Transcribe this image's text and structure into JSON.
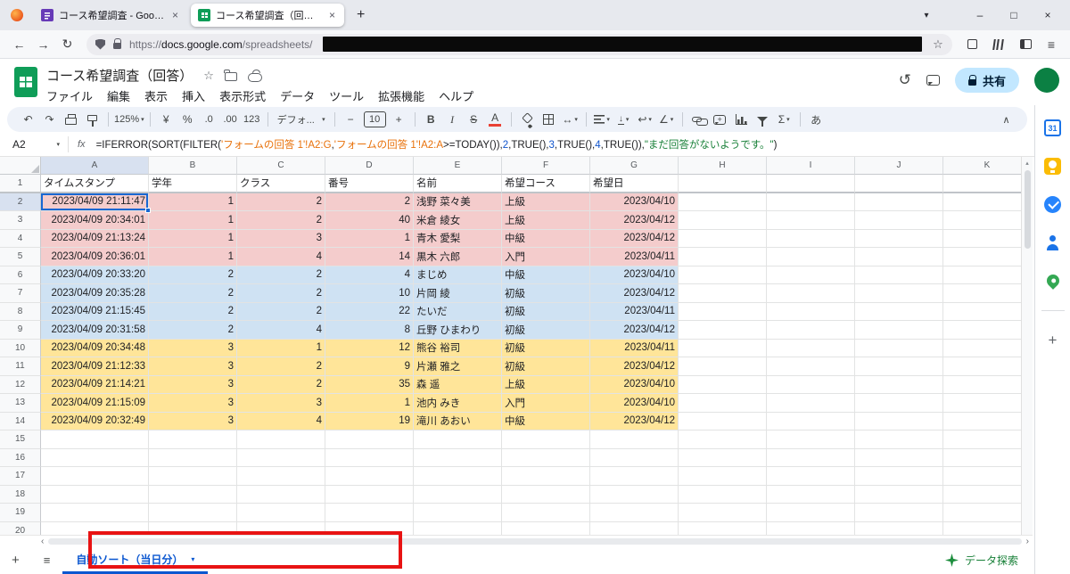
{
  "browser": {
    "tabs": [
      {
        "title": "コース希望調査 - Google フォーム"
      },
      {
        "title": "コース希望調査（回答） - Googl"
      }
    ],
    "url_parts": {
      "scheme": "https://",
      "domain": "docs.google.com",
      "path": "/spreadsheets/"
    }
  },
  "header": {
    "title": "コース希望調査（回答）",
    "menus": [
      "ファイル",
      "編集",
      "表示",
      "挿入",
      "表示形式",
      "データ",
      "ツール",
      "拡張機能",
      "ヘルプ"
    ],
    "share": "共有"
  },
  "toolbar": {
    "zoom": "125%",
    "currency": "¥",
    "percent": "%",
    "decrease_decimal": ".0",
    "increase_decimal": ".00",
    "number_format": "123",
    "font": "デフォ...",
    "font_size": "10",
    "bold": "B",
    "italic": "I",
    "strikethrough": "S",
    "text_color": "A",
    "input_tools": "あ"
  },
  "formula": {
    "cell_ref": "A2",
    "fx_label": "fx",
    "parts": [
      {
        "t": "=IFERROR(SORT(FILTER(",
        "c": "#202124"
      },
      {
        "t": "'フォームの回答 1'!A2:G",
        "c": "#e8710a"
      },
      {
        "t": ",",
        "c": "#202124"
      },
      {
        "t": "'フォームの回答 1'!A2:A",
        "c": "#e8710a"
      },
      {
        "t": ">=TODAY()),",
        "c": "#202124"
      },
      {
        "t": "2",
        "c": "#1155cc"
      },
      {
        "t": ",TRUE(),",
        "c": "#202124"
      },
      {
        "t": "3",
        "c": "#1155cc"
      },
      {
        "t": ",TRUE(),",
        "c": "#202124"
      },
      {
        "t": "4",
        "c": "#1155cc"
      },
      {
        "t": ",TRUE()),",
        "c": "#202124"
      },
      {
        "t": "\"まだ回答がないようです。\"",
        "c": "#188038"
      },
      {
        "t": ")",
        "c": "#202124"
      }
    ]
  },
  "grid": {
    "col_letters": [
      "A",
      "B",
      "C",
      "D",
      "E",
      "F",
      "G",
      "H",
      "I",
      "J",
      "K"
    ],
    "row_count": 20,
    "header_row": [
      "タイムスタンプ",
      "学年",
      "クラス",
      "番号",
      "名前",
      "希望コース",
      "希望日"
    ],
    "aligns": [
      "right",
      "right",
      "right",
      "right",
      "left",
      "left",
      "right"
    ],
    "colors": {
      "pink": "#f4cccc",
      "blue": "#cfe2f3",
      "yellow": "#ffe599"
    },
    "rows": [
      {
        "group": "pink",
        "cells": [
          "2023/04/09 21:11:47",
          "1",
          "2",
          "2",
          "浅野 菜々美",
          "上級",
          "2023/04/10"
        ]
      },
      {
        "group": "pink",
        "cells": [
          "2023/04/09 20:34:01",
          "1",
          "2",
          "40",
          "米倉 綾女",
          "上級",
          "2023/04/12"
        ]
      },
      {
        "group": "pink",
        "cells": [
          "2023/04/09 21:13:24",
          "1",
          "3",
          "1",
          "青木 愛梨",
          "中級",
          "2023/04/12"
        ]
      },
      {
        "group": "pink",
        "cells": [
          "2023/04/09 20:36:01",
          "1",
          "4",
          "14",
          "黒木 六郎",
          "入門",
          "2023/04/11"
        ]
      },
      {
        "group": "blue",
        "cells": [
          "2023/04/09 20:33:20",
          "2",
          "2",
          "4",
          "まじめ",
          "中級",
          "2023/04/10"
        ]
      },
      {
        "group": "blue",
        "cells": [
          "2023/04/09 20:35:28",
          "2",
          "2",
          "10",
          "片岡 綾",
          "初級",
          "2023/04/12"
        ]
      },
      {
        "group": "blue",
        "cells": [
          "2023/04/09 21:15:45",
          "2",
          "2",
          "22",
          "たいだ",
          "初級",
          "2023/04/11"
        ]
      },
      {
        "group": "blue",
        "cells": [
          "2023/04/09 20:31:58",
          "2",
          "4",
          "8",
          "丘野 ひまわり",
          "初級",
          "2023/04/12"
        ]
      },
      {
        "group": "yellow",
        "cells": [
          "2023/04/09 20:34:48",
          "3",
          "1",
          "12",
          "熊谷 裕司",
          "初級",
          "2023/04/11"
        ]
      },
      {
        "group": "yellow",
        "cells": [
          "2023/04/09 21:12:33",
          "3",
          "2",
          "9",
          "片瀬 雅之",
          "初級",
          "2023/04/12"
        ]
      },
      {
        "group": "yellow",
        "cells": [
          "2023/04/09 21:14:21",
          "3",
          "2",
          "35",
          "森 遥",
          "上級",
          "2023/04/10"
        ]
      },
      {
        "group": "yellow",
        "cells": [
          "2023/04/09 21:15:09",
          "3",
          "3",
          "1",
          "池内 みき",
          "入門",
          "2023/04/10"
        ]
      },
      {
        "group": "yellow",
        "cells": [
          "2023/04/09 20:32:49",
          "3",
          "4",
          "19",
          "滝川 あおい",
          "中級",
          "2023/04/12"
        ]
      }
    ]
  },
  "sheetbar": {
    "active_tab": "自動ソート（当日分）",
    "explore": "データ探索"
  },
  "sidepanel": {
    "calendar_label": "31"
  },
  "icons": {
    "back": "←",
    "forward": "→",
    "reload": "↻",
    "star": "☆",
    "tab_chevron": "▾",
    "minimize": "–",
    "maximize": "□",
    "close": "×",
    "new_tab": "+",
    "menu": "≡",
    "undo": "↶",
    "redo": "↷",
    "caret": "▾",
    "minus": "−",
    "plus": "+",
    "sigma": "Σ",
    "history": "↺",
    "collapse": "∧",
    "wrap": "↩",
    "rotate": "∠",
    "down_arrow": "↓",
    "merge": "↔",
    "scroll_left": "‹",
    "scroll_right": "›",
    "scroll_up": "▴",
    "scroll_down": "▾",
    "sheet_plus": "+",
    "all_sheets": "≡"
  }
}
